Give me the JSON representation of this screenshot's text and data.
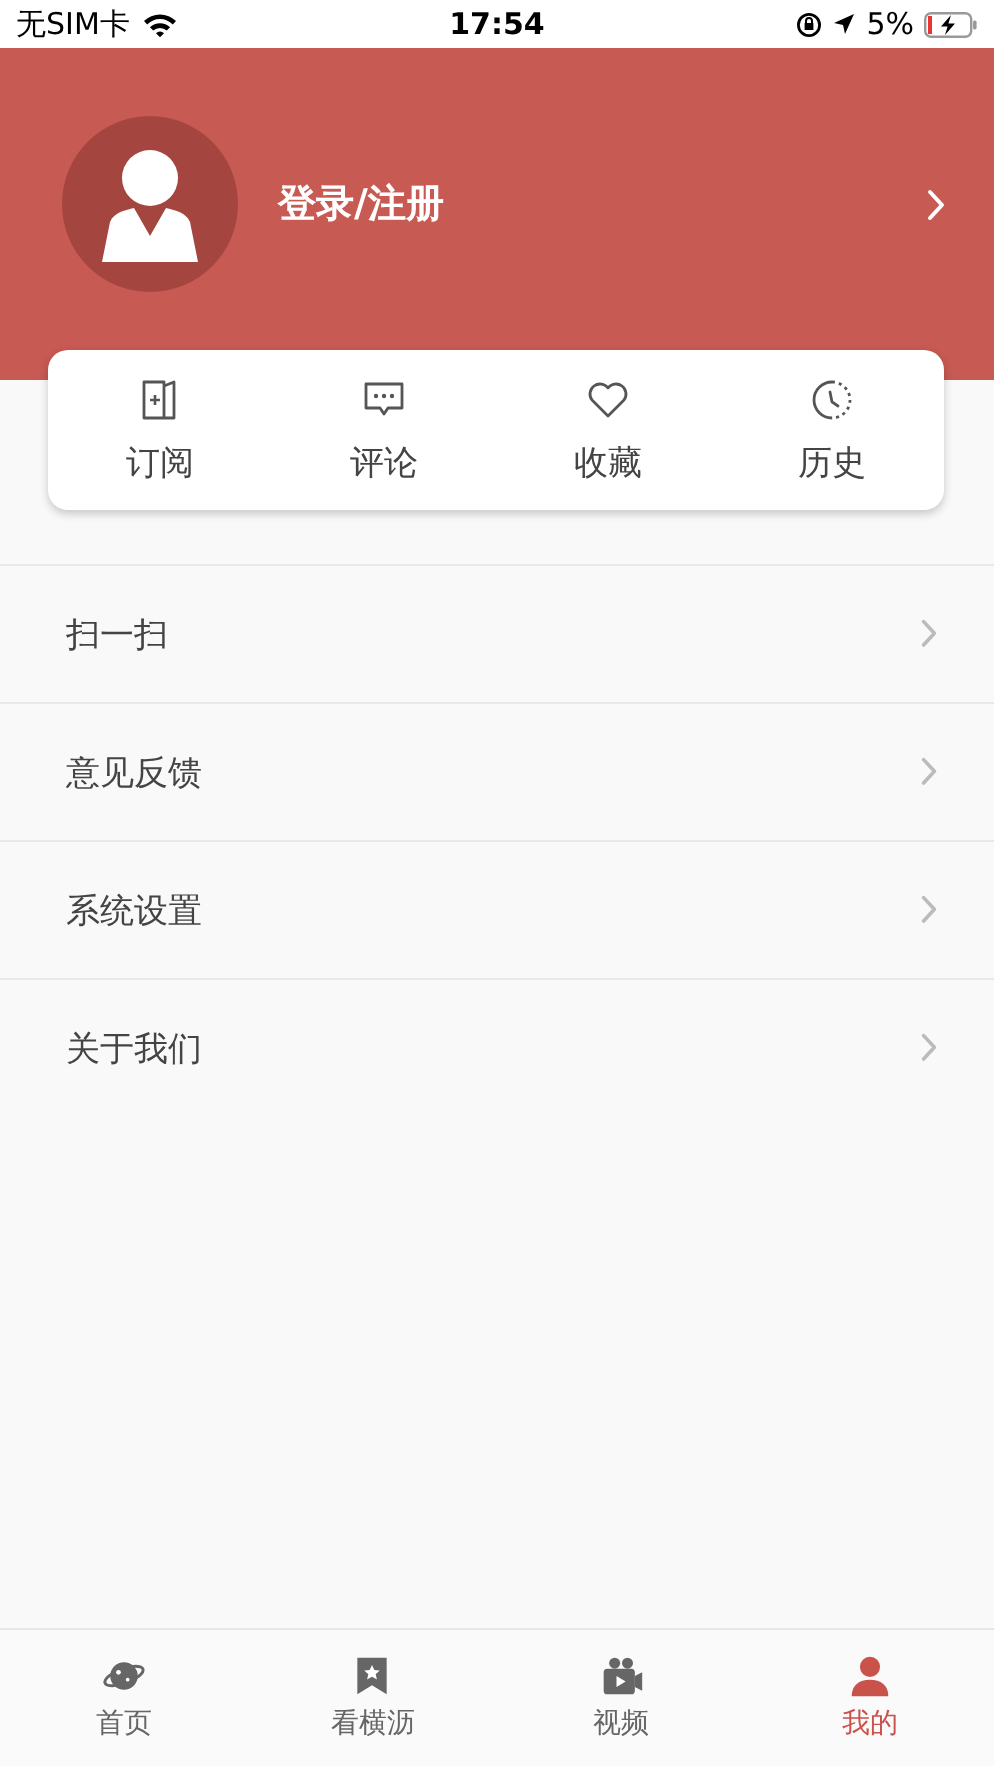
{
  "status_bar": {
    "carrier": "无SIM卡",
    "time": "17:54",
    "battery": "5%"
  },
  "profile": {
    "login": "登录/注册"
  },
  "shortcuts": [
    {
      "label": "订阅",
      "kind": "subscribe"
    },
    {
      "label": "评论",
      "kind": "comment"
    },
    {
      "label": "收藏",
      "kind": "favorite"
    },
    {
      "label": "历史",
      "kind": "history"
    }
  ],
  "menu": [
    "扫一扫",
    "意见反馈",
    "系统设置",
    "关于我们"
  ],
  "tab_bar": [
    {
      "label": "首页",
      "kind": "planet",
      "selected": false
    },
    {
      "label": "看横沥",
      "kind": "bookmark",
      "selected": false
    },
    {
      "label": "视频",
      "kind": "video",
      "selected": false
    },
    {
      "label": "我的",
      "kind": "person",
      "selected": true
    }
  ]
}
